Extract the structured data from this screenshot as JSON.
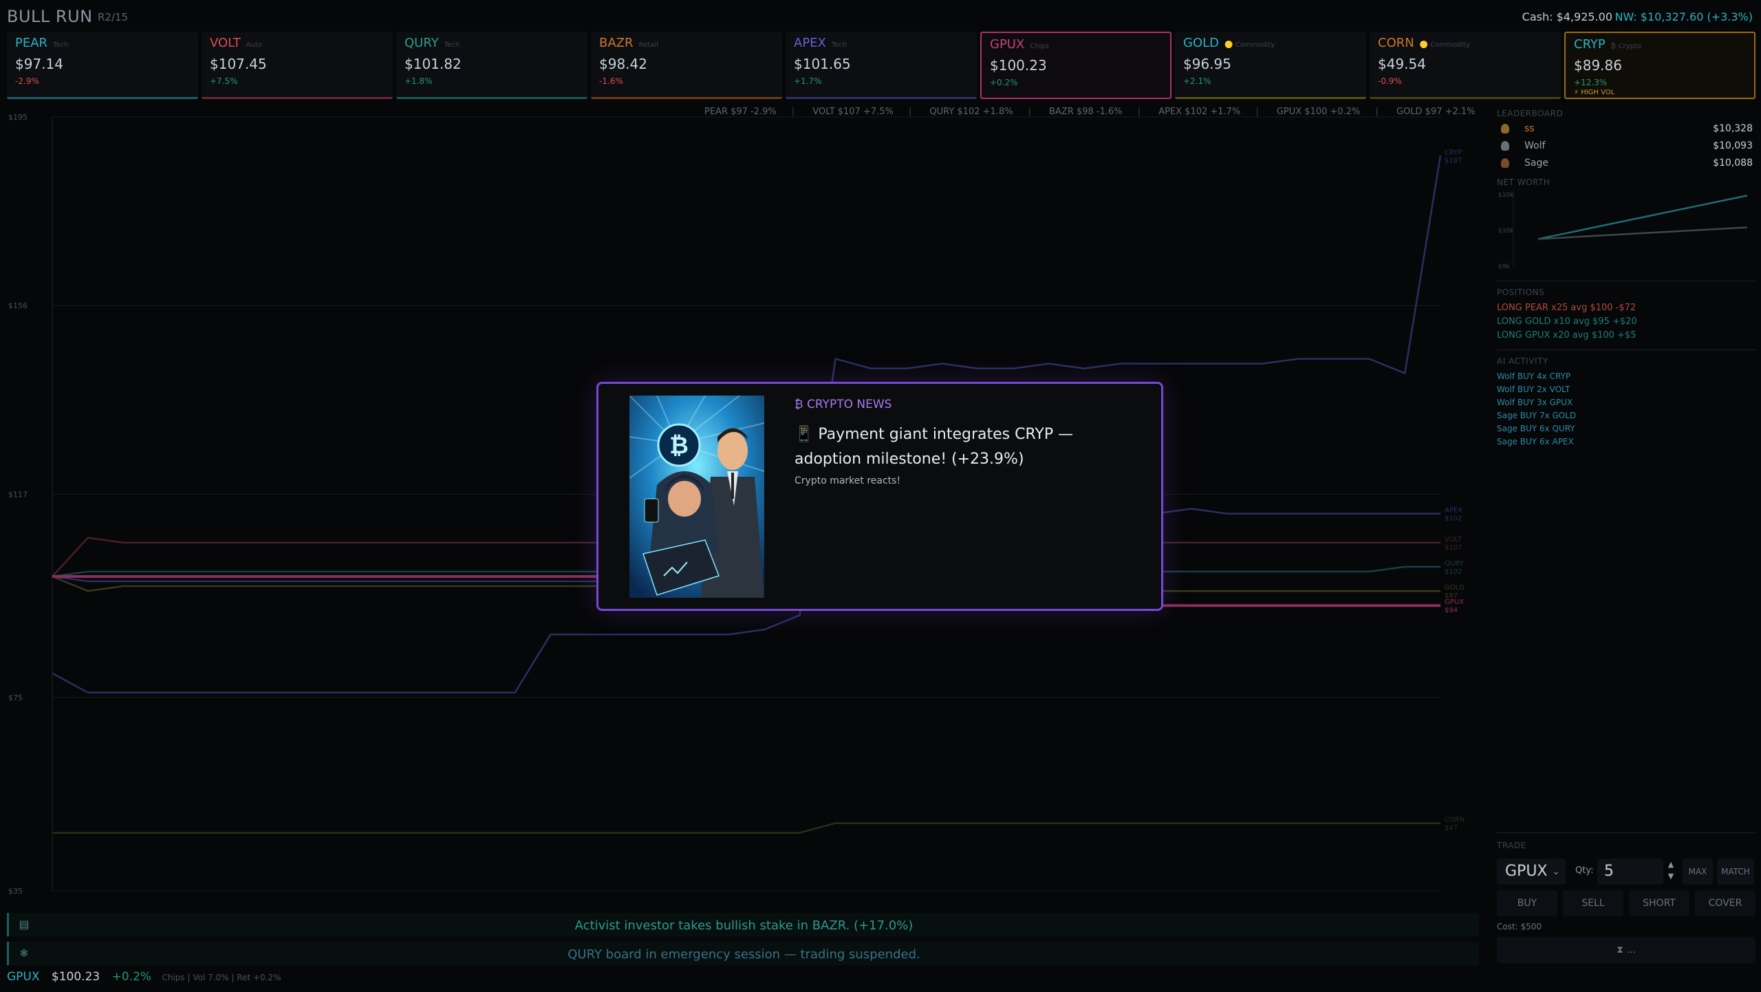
{
  "header": {
    "brand": "BULL RUN",
    "round": "R2/15",
    "cash": "Cash: $4,925.00",
    "net_worth": "NW: $10,327.60 (+3.3%)"
  },
  "tickers": [
    {
      "symbol": "PEAR",
      "sector": "Tech",
      "price": "$97.14",
      "change": "-2.9%",
      "color": "#2bb3c0",
      "chg_color": "#d94f4f"
    },
    {
      "symbol": "VOLT",
      "sector": "Auto",
      "price": "$107.45",
      "change": "+7.5%",
      "color": "#d94f4f",
      "chg_color": "#1f9a6e"
    },
    {
      "symbol": "QURY",
      "sector": "Tech",
      "price": "$101.82",
      "change": "+1.8%",
      "color": "#2f9e8e",
      "chg_color": "#1f9a6e"
    },
    {
      "symbol": "BAZR",
      "sector": "Retail",
      "price": "$98.42",
      "change": "-1.6%",
      "color": "#d0762a",
      "chg_color": "#d94f4f"
    },
    {
      "symbol": "APEX",
      "sector": "Tech",
      "price": "$101.65",
      "change": "+1.7%",
      "color": "#6b5fd0",
      "chg_color": "#1f9a6e"
    },
    {
      "symbol": "GPUX",
      "sector": "Chips",
      "price": "$100.23",
      "change": "+0.2%",
      "color": "#c5407e",
      "chg_color": "#1f9a6e"
    },
    {
      "symbol": "GOLD",
      "sector": "Commodity",
      "price": "$96.95",
      "change": "+2.1%",
      "color": "#2bb3c0",
      "chg_color": "#1f9a6e"
    },
    {
      "symbol": "CORN",
      "sector": "Commodity",
      "price": "$49.54",
      "change": "-0.9%",
      "color": "#d0762a",
      "chg_color": "#d94f4f"
    },
    {
      "symbol": "CRYP",
      "sector": "Crypto",
      "price": "$89.86",
      "change": "+12.3%",
      "color": "#2bb3c0",
      "chg_color": "#1f9a6e",
      "badge": "HIGH VOL"
    }
  ],
  "tape": [
    "PEAR $97 -2.9%",
    "VOLT $107 +7.5%",
    "QURY $102 +1.8%",
    "BAZR $98 -1.6%",
    "APEX $102 +1.7%",
    "GPUX $100 +0.2%",
    "GOLD $97 +2.1%"
  ],
  "chart_data": {
    "type": "line",
    "title": "",
    "xlabel": "",
    "ylabel": "",
    "ylim": [
      35,
      195
    ],
    "yticks": [
      "$195",
      "$156",
      "$117",
      "$75",
      "$35"
    ],
    "grid": true,
    "series": [
      {
        "name": "CRYP",
        "color": "#2a2f63",
        "values": [
          80,
          76,
          76,
          76,
          76,
          76,
          76,
          76,
          76,
          76,
          76,
          76,
          76,
          76,
          88,
          88,
          88,
          88,
          88,
          88,
          89,
          92,
          145,
          143,
          143,
          144,
          143,
          143,
          144,
          143,
          144,
          144,
          144,
          144,
          144,
          145,
          145,
          145,
          142,
          187
        ]
      },
      {
        "name": "VOLT",
        "color": "#4a1f2c",
        "values": [
          100,
          108,
          107,
          107,
          107,
          107,
          107,
          107,
          107,
          107,
          107,
          107,
          107,
          107,
          107,
          107,
          107,
          107,
          107,
          107,
          107,
          107,
          107,
          107,
          107,
          107,
          107,
          107,
          107,
          107,
          107,
          107,
          107,
          107,
          107,
          107,
          107,
          107,
          107,
          107
        ]
      },
      {
        "name": "APEX",
        "color": "#2a2f63",
        "values": [
          100,
          99,
          99,
          99,
          99,
          99,
          99,
          99,
          99,
          99,
          99,
          99,
          99,
          99,
          99,
          99,
          99,
          99,
          99,
          99,
          99,
          99,
          95,
          95,
          95,
          95,
          95,
          95,
          95,
          95,
          98,
          113,
          114,
          113,
          113,
          113,
          113,
          113,
          113,
          113
        ]
      },
      {
        "name": "QURY",
        "color": "#1b3f45",
        "values": [
          100,
          101,
          101,
          101,
          101,
          101,
          101,
          101,
          101,
          101,
          101,
          101,
          101,
          101,
          101,
          101,
          101,
          101,
          101,
          101,
          101,
          101,
          101,
          101,
          101,
          101,
          101,
          101,
          101,
          101,
          101,
          101,
          101,
          101,
          101,
          101,
          101,
          101,
          102,
          102
        ]
      },
      {
        "name": "GOLD",
        "color": "#3a3a1c",
        "values": [
          100,
          97,
          98,
          98,
          98,
          98,
          98,
          98,
          98,
          98,
          98,
          98,
          98,
          98,
          98,
          98,
          98,
          98,
          98,
          98,
          98,
          98,
          97,
          97,
          97,
          97,
          97,
          97,
          97,
          97,
          97,
          97,
          97,
          97,
          97,
          97,
          97,
          97,
          97,
          97
        ]
      },
      {
        "name": "GPUX",
        "color": "#8a2f5c",
        "values": [
          100,
          100,
          100,
          100,
          100,
          100,
          100,
          100,
          100,
          100,
          100,
          100,
          100,
          100,
          100,
          100,
          100,
          100,
          100,
          100,
          100,
          100,
          94,
          94,
          94,
          94,
          94,
          94,
          94,
          94,
          94,
          94,
          94,
          94,
          94,
          94,
          94,
          94,
          94,
          94
        ]
      },
      {
        "name": "CORN",
        "color": "#2a2f18",
        "values": [
          47,
          47,
          47,
          47,
          47,
          47,
          47,
          47,
          47,
          47,
          47,
          47,
          47,
          47,
          47,
          47,
          47,
          47,
          47,
          47,
          47,
          47,
          49,
          49,
          49,
          49,
          49,
          49,
          49,
          49,
          49,
          49,
          49,
          49,
          49,
          49,
          49,
          49,
          49,
          49
        ]
      }
    ],
    "end_labels": [
      {
        "name": "CRYP",
        "value": "$187"
      },
      {
        "name": "VOLT",
        "value": "$107"
      },
      {
        "name": "QURY",
        "value": "$102"
      },
      {
        "name": "APEX",
        "value": "$102"
      },
      {
        "name": "GOLD",
        "value": "$97"
      },
      {
        "name": "GPUX",
        "value": "$94"
      },
      {
        "name": "CORN",
        "value": "$47"
      }
    ]
  },
  "news": [
    {
      "icon": "chart-icon",
      "text": "Activist investor takes bullish stake in BAZR. (+17.0%)"
    },
    {
      "icon": "snowflake-icon",
      "text": "QURY board in emergency session — trading suspended."
    }
  ],
  "status": {
    "symbol": "GPUX",
    "price": "$100.23",
    "change": "+0.2%",
    "meta": "Chips | Vol 7.0% | Ret +0.2%"
  },
  "leaderboard": {
    "title": "LEADERBOARD",
    "rows": [
      {
        "name": "ss",
        "value": "$10,328"
      },
      {
        "name": "Wolf",
        "value": "$10,093"
      },
      {
        "name": "Sage",
        "value": "$10,088"
      }
    ]
  },
  "networth": {
    "title": "NET WORTH",
    "yticks": [
      "$10k",
      "$10k",
      "$9k"
    ],
    "series": [
      {
        "name": "ss",
        "color": "#1f6b78",
        "values": [
          10000,
          10328
        ]
      },
      {
        "name": "Sage",
        "color": "#3a4a4a",
        "values": [
          10000,
          10088
        ]
      }
    ]
  },
  "positions": {
    "title": "POSITIONS",
    "items": [
      {
        "text": "LONG PEAR x25  avg $100  -$72",
        "color": "#b24a3e"
      },
      {
        "text": "LONG GOLD x10  avg $95  +$20",
        "color": "#1f7f7a"
      },
      {
        "text": "LONG GPUX x20  avg $100  +$5",
        "color": "#1f7f7a"
      }
    ]
  },
  "ai_activity": {
    "title": "AI ACTIVITY",
    "items": [
      "Wolf BUY 4x CRYP",
      "Wolf BUY 2x VOLT",
      "Wolf BUY 3x GPUX",
      "Sage BUY 7x GOLD",
      "Sage BUY 6x QURY",
      "Sage BUY 6x APEX"
    ]
  },
  "trade": {
    "title": "TRADE",
    "symbol": "GPUX",
    "qty_label": "Qty:",
    "qty": "5",
    "max": "MAX",
    "match": "MATCH",
    "buy": "BUY",
    "sell": "SELL",
    "short": "SHORT",
    "cover": "COVER",
    "cost": "Cost: $500",
    "end_turn": "..."
  },
  "modal": {
    "category": "₿ CRYPTO NEWS",
    "headline": "📱 Payment giant integrates CRYP — adoption milestone! (+23.9%)",
    "subtext": "Crypto market reacts!"
  }
}
